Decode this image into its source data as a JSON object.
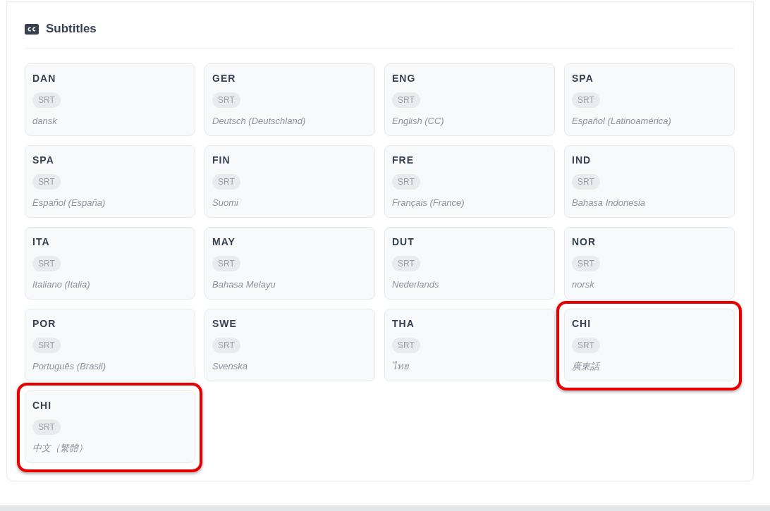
{
  "section": {
    "title": "Subtitles"
  },
  "subtitles": [
    {
      "code": "DAN",
      "format": "SRT",
      "language": "dansk",
      "highlighted": false
    },
    {
      "code": "GER",
      "format": "SRT",
      "language": "Deutsch (Deutschland)",
      "highlighted": false
    },
    {
      "code": "ENG",
      "format": "SRT",
      "language": "English (CC)",
      "highlighted": false
    },
    {
      "code": "SPA",
      "format": "SRT",
      "language": "Español (Latinoamérica)",
      "highlighted": false
    },
    {
      "code": "SPA",
      "format": "SRT",
      "language": "Español (España)",
      "highlighted": false
    },
    {
      "code": "FIN",
      "format": "SRT",
      "language": "Suomi",
      "highlighted": false
    },
    {
      "code": "FRE",
      "format": "SRT",
      "language": "Français (France)",
      "highlighted": false
    },
    {
      "code": "IND",
      "format": "SRT",
      "language": "Bahasa Indonesia",
      "highlighted": false
    },
    {
      "code": "ITA",
      "format": "SRT",
      "language": "Italiano (Italia)",
      "highlighted": false
    },
    {
      "code": "MAY",
      "format": "SRT",
      "language": "Bahasa Melayu",
      "highlighted": false
    },
    {
      "code": "DUT",
      "format": "SRT",
      "language": "Nederlands",
      "highlighted": false
    },
    {
      "code": "NOR",
      "format": "SRT",
      "language": "norsk",
      "highlighted": false
    },
    {
      "code": "POR",
      "format": "SRT",
      "language": "Português (Brasil)",
      "highlighted": false
    },
    {
      "code": "SWE",
      "format": "SRT",
      "language": "Svenska",
      "highlighted": false
    },
    {
      "code": "THA",
      "format": "SRT",
      "language": "ไทย",
      "highlighted": false
    },
    {
      "code": "CHI",
      "format": "SRT",
      "language": "廣東話",
      "highlighted": true
    },
    {
      "code": "CHI",
      "format": "SRT",
      "language": "中文（繁體）",
      "highlighted": true
    }
  ]
}
